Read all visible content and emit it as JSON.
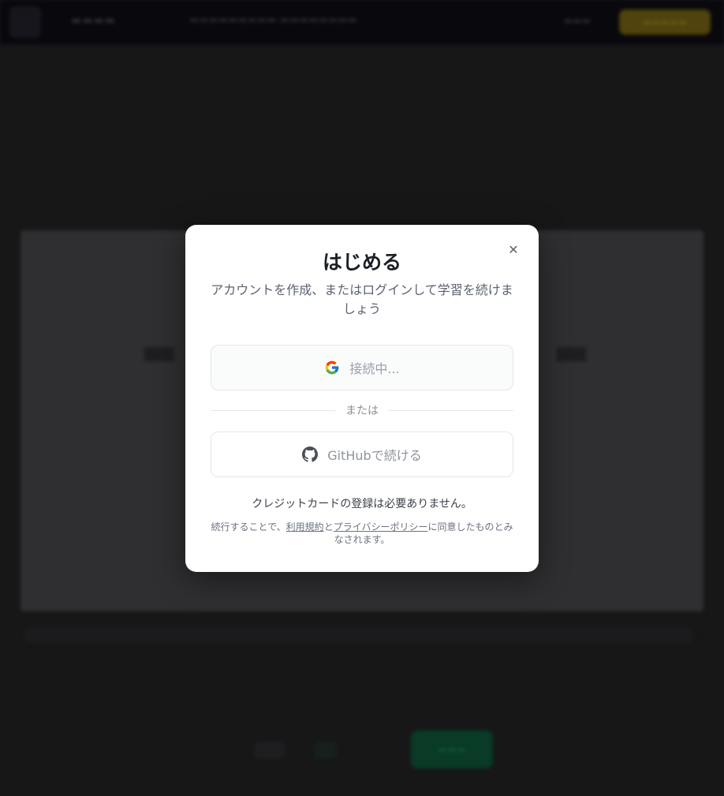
{
  "modal": {
    "title": "はじめる",
    "subtitle": "アカウントを作成、またはログインして学習を続けましょう",
    "close_icon": "close-icon",
    "google_button": {
      "label": "接続中...",
      "icon": "google-icon"
    },
    "divider_text": "または",
    "github_button": {
      "label": "GitHubで続ける",
      "icon": "github-icon"
    },
    "no_card_note": "クレジットカードの登録は必要ありません。",
    "terms": {
      "prefix": "続行することで、",
      "terms_link": "利用規約",
      "conjunction": "と",
      "privacy_link": "プライバシーポリシー",
      "suffix": "に同意したものとみなされます。"
    }
  },
  "colors": {
    "overlay": "#1f1f21",
    "accent_yellow": "#6b5a12",
    "accent_green": "#0c4f33",
    "title_text": "#1b1f26"
  }
}
